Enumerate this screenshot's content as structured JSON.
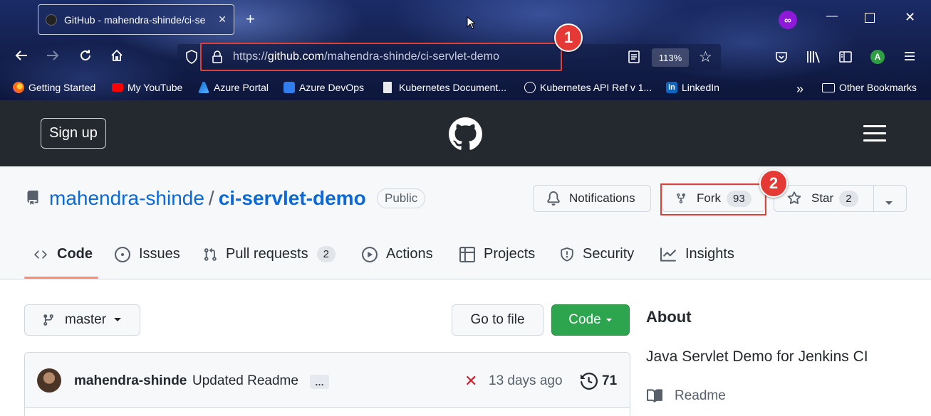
{
  "browser": {
    "tab_title": "GitHub - mahendra-shinde/ci-se",
    "url_prefix": "https://",
    "url_domain": "github.com",
    "url_path": "/mahendra-shinde/ci-servlet-demo",
    "zoom": "113%",
    "account_initial": "A",
    "bookmarks": [
      "Getting Started",
      "My YouTube",
      "Azure Portal",
      "Azure DevOps",
      "Kubernetes Document...",
      "Kubernetes API Ref v 1...",
      "LinkedIn",
      "Other Bookmarks"
    ]
  },
  "callouts": [
    "1",
    "2"
  ],
  "github": {
    "signup_label": "Sign up",
    "owner": "mahendra-shinde",
    "separator": "/",
    "repo": "ci-servlet-demo",
    "visibility": "Public",
    "notifications_label": "Notifications",
    "fork_label": "Fork",
    "fork_count": "93",
    "star_label": "Star",
    "star_count": "2",
    "tabs": [
      {
        "label": "Code"
      },
      {
        "label": "Issues"
      },
      {
        "label": "Pull requests",
        "count": "2"
      },
      {
        "label": "Actions"
      },
      {
        "label": "Projects"
      },
      {
        "label": "Security"
      },
      {
        "label": "Insights"
      }
    ],
    "branch": "master",
    "go_to_file": "Go to file",
    "code_button": "Code",
    "commit": {
      "author": "mahendra-shinde",
      "message": "Updated Readme",
      "ellipsis": "…",
      "time": "13 days ago",
      "count": "71"
    },
    "about": {
      "title": "About",
      "description": "Java Servlet Demo for Jenkins CI",
      "readme": "Readme"
    }
  },
  "colors": {
    "accent_red": "#e53935",
    "github_dark": "#24292f",
    "link_blue": "#0969da",
    "code_green": "#2da44e"
  }
}
